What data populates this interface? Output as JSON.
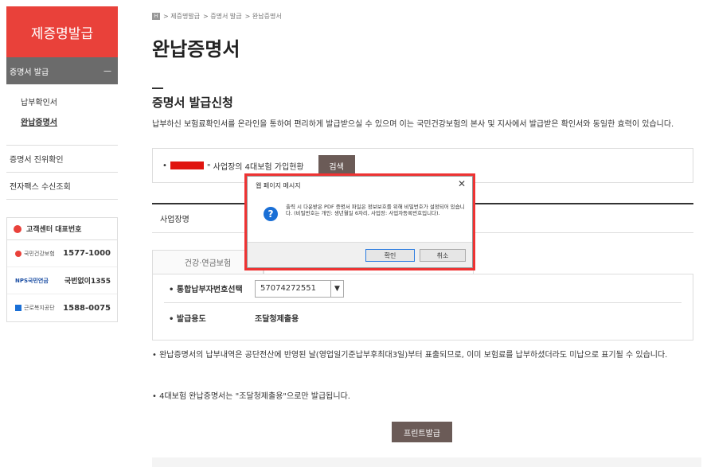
{
  "sidebar": {
    "header": "제증명발급",
    "section": "증명서 발급",
    "section_toggle": "—",
    "sub_items": [
      "납부확인서",
      "완납증명서"
    ],
    "items": [
      "증명서 진위확인",
      "전자팩스 수신조회"
    ],
    "cs_title": "고객센터 대표번호",
    "cs": [
      {
        "org": "국민건강보험",
        "number": "1577-1000"
      },
      {
        "org": "NPS국민연금",
        "number": "국번없이1355"
      },
      {
        "org": "근로복지공단",
        "number": "1588-0075"
      }
    ]
  },
  "breadcrumb": {
    "home": "H",
    "items": [
      "> 제증명발급",
      "> 증명서 발급",
      "> 완납증명서"
    ]
  },
  "page_title": "완납증명서",
  "section_title": "증명서 발급신청",
  "description": "납부하신 보험료확인서를 온라인을 통하여 편리하게 발급받으실 수 있으며 이는 국민건강보험의 본사 및 지사에서 발급받은 확인서와 동일한 효력이 있습니다.",
  "search": {
    "bullet": "•",
    "label": "\" 사업장의 4대보험 가입현황",
    "button": "검색"
  },
  "biz_label": "사업장명",
  "tabs": [
    "건강·연금보험",
    ""
  ],
  "form": {
    "row1_label": "• 통합납부자번호선택",
    "row1_value": "57074272551",
    "row2_label": "• 발급용도",
    "row2_value": "조달청제출용"
  },
  "note1": "• 완납증명서의 납부내역은 공단전산에 반영된 날(영업일기준납부후최대3일)부터 표출되므로, 이미 보험료를 납부하셨더라도 미납으로 표기될 수 있습니다.",
  "note2": "• 4대보험 완납증명서는 \"조달청제출용\"으로만 발급됩니다.",
  "print_button": "프린트발급",
  "dialog": {
    "title": "웹 페이지 메시지",
    "close": "✕",
    "icon": "?",
    "message": "출력 시 다운받은 PDF 증명서 파일은 정보보호를 위해 비밀번호가 설정되어 있습니다. (비밀번호는 개인: 생년월일 6자리, 사업장: 사업자등록번호입니다).",
    "ok": "확인",
    "cancel": "취소"
  },
  "colors": {
    "accent": "#e9413a",
    "button": "#6b5b57",
    "dialog_border": "#e33333"
  }
}
